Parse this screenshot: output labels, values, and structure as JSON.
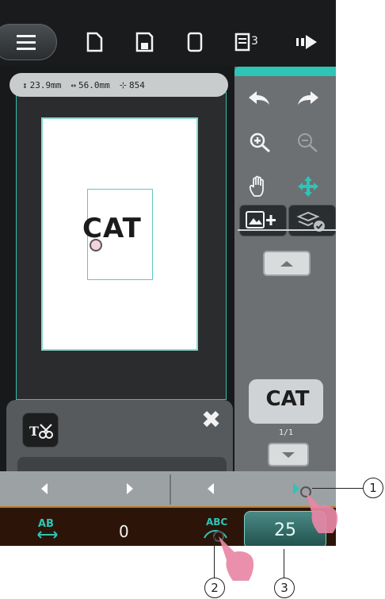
{
  "status": {
    "height": "23.9mm",
    "width": "56.0mm",
    "stitches": "854"
  },
  "toolbar": {
    "menu_icon": "hamburger-menu-icon",
    "page_count": "3"
  },
  "canvas": {
    "design_text": "CAT"
  },
  "side_panel": {
    "preview_text": "CAT",
    "page_indicator": "1/1"
  },
  "bottom_bar": {
    "spacing_value": "0",
    "current_value": "25"
  },
  "callouts": {
    "one": "1",
    "two": "2",
    "three": "3"
  },
  "colors": {
    "accent": "#2ec4b6",
    "bottom_bar": "#2c1508",
    "pink_hand": "#e887a6"
  }
}
